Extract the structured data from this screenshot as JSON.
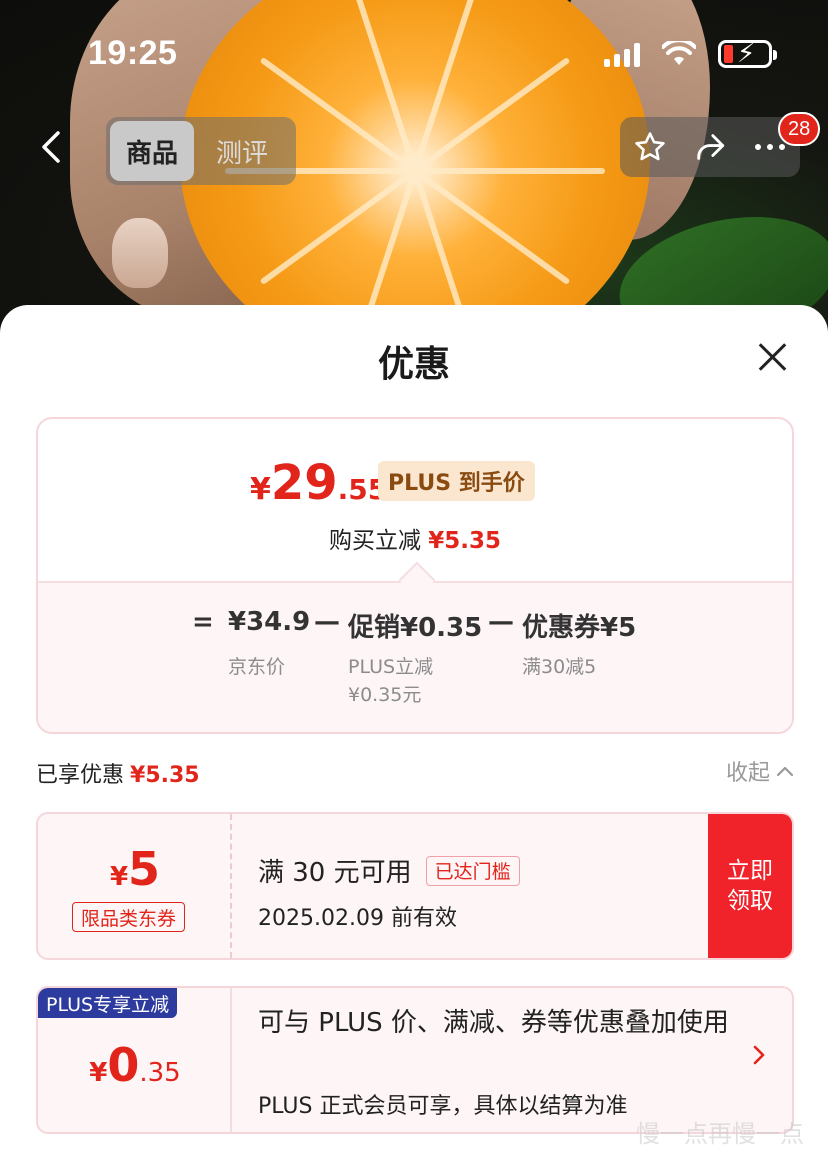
{
  "status_bar": {
    "time": "19:25"
  },
  "nav": {
    "tabs": [
      {
        "label": "商品",
        "active": true
      },
      {
        "label": "测评",
        "active": false
      }
    ],
    "cart_badge": "28"
  },
  "sheet": {
    "title": "优惠",
    "price_card": {
      "yen": "¥",
      "price_int": "29",
      "price_dec": ".55",
      "plus_tag": "PLUS 到手价",
      "instant_label": "购买立减",
      "instant_value": "¥5.35",
      "formula": {
        "eq": "=",
        "jd_price": "¥34.9",
        "minus1": "—",
        "promo": "促销¥0.35",
        "minus2": "—",
        "coupon": "优惠券¥5",
        "jd_price_label": "京东价",
        "promo_label_1": "PLUS立减",
        "promo_label_2": "¥0.35元",
        "coupon_label": "满30减5"
      }
    },
    "enjoyed": {
      "label": "已享优惠",
      "value": "¥5.35",
      "collapse": "收起"
    },
    "coupon": {
      "yen": "¥",
      "amount": "5",
      "type": "限品类东券",
      "condition": "满 30 元可用",
      "reached": "已达门槛",
      "valid": "2025.02.09 前有效",
      "claim_line1": "立即",
      "claim_line2": "领取"
    },
    "plus_offer": {
      "ribbon": "PLUS专享立减",
      "yen": "¥",
      "amount_int": "0",
      "amount_dec": ".35",
      "desc": "可与 PLUS 价、满减、券等优惠叠加使用",
      "note": "PLUS 正式会员可享，具体以结算为准"
    }
  },
  "watermark": "慢一点再慢一点",
  "colors": {
    "accent_red": "#e1251b",
    "plus_blue": "#2d3a9e",
    "plus_gold_bg": "#fbe6cf"
  }
}
